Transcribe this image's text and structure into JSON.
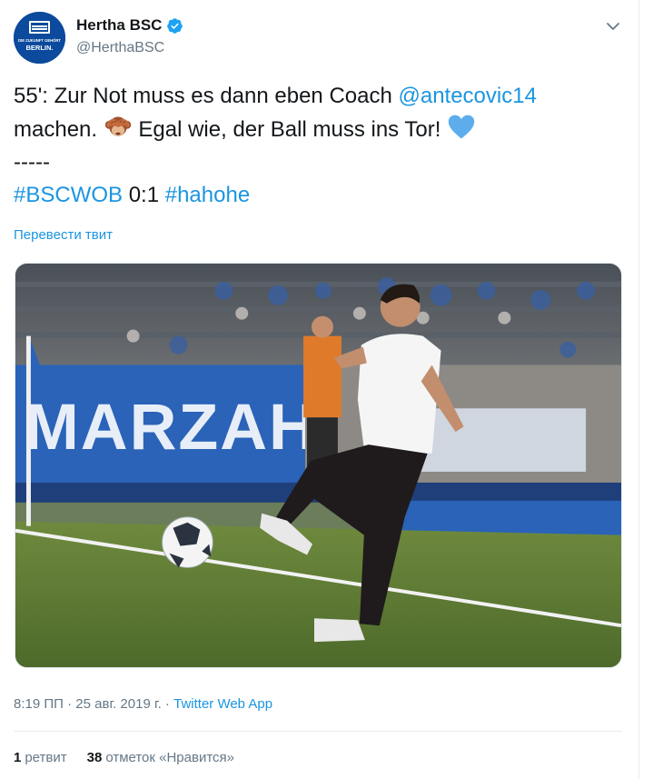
{
  "account": {
    "display_name": "Hertha BSC",
    "handle": "@HerthaBSC",
    "verified": true,
    "avatar_text": [
      "DIE ZUKUNFT GEHÖRT",
      "BERLIN."
    ]
  },
  "tweet": {
    "line1_prefix": "55': Zur Not muss es dann eben Coach ",
    "mention": "@antecovic14",
    "line2_prefix": "machen. ",
    "emoji": "see-no-evil-monkey",
    "line2_suffix": " Egal wie, der Ball muss ins Tor! ",
    "heart_emoji": "blue-heart",
    "separator": "-----",
    "hashtag1": "#BSCWOB",
    "score": " 0:1 ",
    "hashtag2": "#hahohe"
  },
  "translate_label": "Перевести твит",
  "media": {
    "description_icon": "photo",
    "banner_text": "MARZAHN"
  },
  "meta": {
    "time": "8:19 ПП",
    "separator": " · ",
    "date": "25 авг. 2019 г.",
    "separator2": " · ",
    "source": "Twitter Web App"
  },
  "stats": {
    "retweets_count": "1",
    "retweets_label": "ретвит",
    "likes_count": "38",
    "likes_label": "отметок «Нравится»"
  },
  "colors": {
    "link": "#1b95e0",
    "verified": "#1da1f2",
    "heart": "#5dadec",
    "secondary": "#657786"
  }
}
